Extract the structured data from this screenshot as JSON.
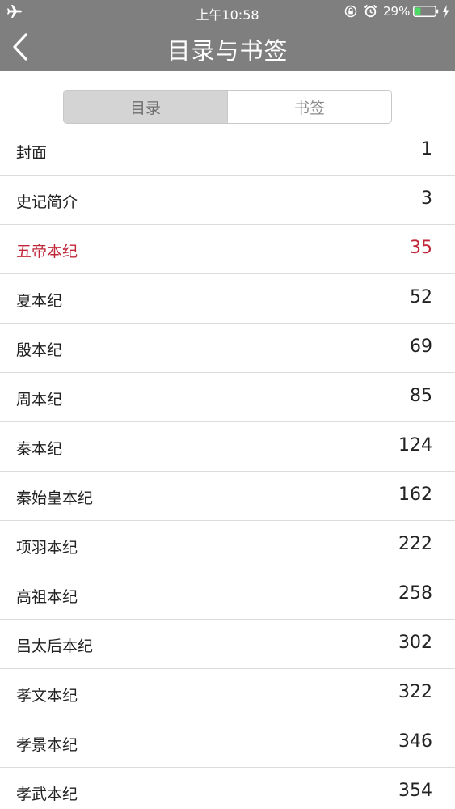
{
  "status_bar": {
    "time": "上午10:58",
    "battery_percent": "29%",
    "battery_level": 0.29,
    "battery_color": "#4cd964",
    "icons": [
      "airplane-icon",
      "orientation-lock-icon",
      "alarm-icon",
      "battery-icon",
      "charging-bolt-icon"
    ]
  },
  "nav": {
    "title": "目录与书签",
    "back_icon": "chevron-left-icon"
  },
  "tabs": [
    {
      "label": "目录",
      "active": true
    },
    {
      "label": "书签",
      "active": false
    }
  ],
  "colors": {
    "header_bg": "#7f7f7f",
    "current_chapter": "#c0283a"
  },
  "toc": [
    {
      "title": "封面",
      "page": "1",
      "current": false
    },
    {
      "title": "史记简介",
      "page": "3",
      "current": false
    },
    {
      "title": "五帝本纪",
      "page": "35",
      "current": true
    },
    {
      "title": "夏本纪",
      "page": "52",
      "current": false
    },
    {
      "title": "殷本纪",
      "page": "69",
      "current": false
    },
    {
      "title": "周本纪",
      "page": "85",
      "current": false
    },
    {
      "title": "秦本纪",
      "page": "124",
      "current": false
    },
    {
      "title": "秦始皇本纪",
      "page": "162",
      "current": false
    },
    {
      "title": "项羽本纪",
      "page": "222",
      "current": false
    },
    {
      "title": "高祖本纪",
      "page": "258",
      "current": false
    },
    {
      "title": "吕太后本纪",
      "page": "302",
      "current": false
    },
    {
      "title": "孝文本纪",
      "page": "322",
      "current": false
    },
    {
      "title": "孝景本纪",
      "page": "346",
      "current": false
    },
    {
      "title": "孝武本纪",
      "page": "354",
      "current": false
    }
  ]
}
